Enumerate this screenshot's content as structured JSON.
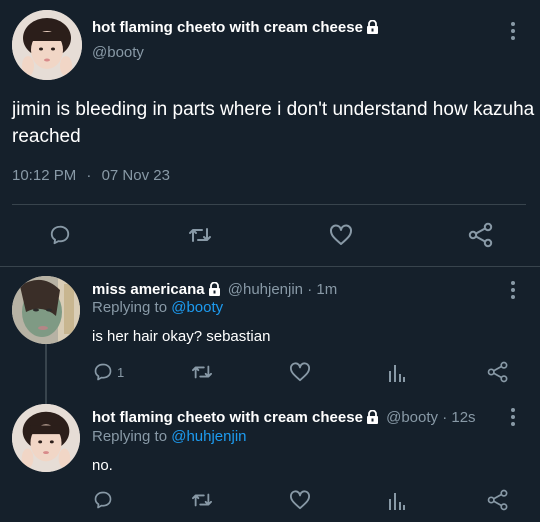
{
  "main_tweet": {
    "display_name": "hot flaming cheeto with cream cheese",
    "handle": "@booty",
    "text": "jimin is bleeding in parts where i don't understand how kazuha reached",
    "time": "10:12 PM",
    "separator": "·",
    "date": "07 Nov 23"
  },
  "reply1": {
    "display_name": "miss americana",
    "handle": "@huhjenjin",
    "meta_sep": "·",
    "age": "1m",
    "replying_prefix": "Replying to",
    "replying_to": "@booty",
    "text": "is her hair okay? sebastian",
    "reply_count": "1"
  },
  "reply2": {
    "display_name": "hot flaming cheeto with cream cheese",
    "handle": "@booty",
    "meta_sep": "·",
    "age": "12s",
    "replying_prefix": "Replying to",
    "replying_to": "@huhjenjin",
    "text": "no."
  },
  "colors": {
    "background": "#15202b",
    "text": "#ffffff",
    "muted": "#8899a6",
    "link": "#1d9bf0",
    "divider": "#38444d"
  },
  "icons": [
    "lock-icon",
    "more-icon",
    "reply-icon",
    "retweet-icon",
    "like-icon",
    "share-icon",
    "analytics-icon"
  ]
}
